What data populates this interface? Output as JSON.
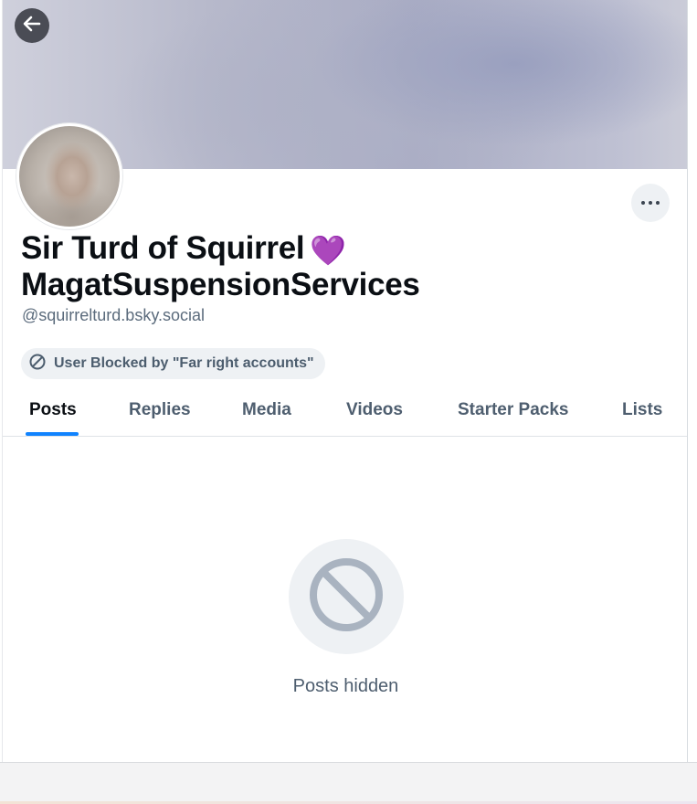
{
  "profile": {
    "display_name_line1": "Sir Turd of Squirrel",
    "heart_emoji": "💜",
    "display_name_line2": "MagatSuspensionServices",
    "handle": "@squirrelturd.bsky.social",
    "blocked_label": "User Blocked by \"Far right accounts\""
  },
  "tabs": [
    {
      "label": "Posts",
      "active": true
    },
    {
      "label": "Replies",
      "active": false
    },
    {
      "label": "Media",
      "active": false
    },
    {
      "label": "Videos",
      "active": false
    },
    {
      "label": "Starter Packs",
      "active": false
    },
    {
      "label": "Lists",
      "active": false
    }
  ],
  "empty_state": {
    "message": "Posts hidden",
    "icon": "block-icon"
  },
  "icons": {
    "back": "arrow-left-icon",
    "more": "ellipsis-icon",
    "blocked": "block-icon"
  },
  "colors": {
    "accent": "#1083fe",
    "muted_text": "#4e5e6f",
    "pill_bg": "#eef1f4",
    "empty_icon_stroke": "#a9b3c0"
  }
}
